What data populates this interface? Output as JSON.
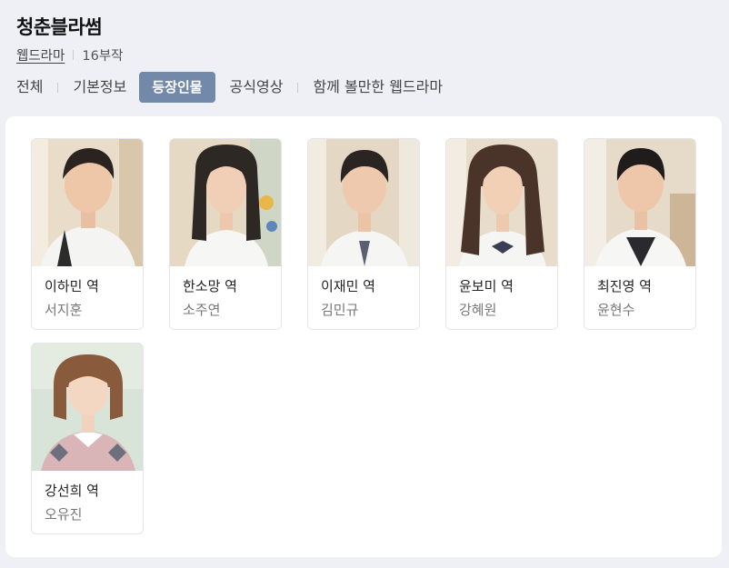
{
  "header": {
    "title": "청춘블라썸",
    "genre": "웹드라마",
    "episodes": "16부작"
  },
  "tabs": [
    {
      "label": "전체"
    },
    {
      "label": "기본정보"
    },
    {
      "label": "등장인물",
      "active": true
    },
    {
      "label": "공식영상"
    },
    {
      "label": "함께 볼만한 웹드라마"
    }
  ],
  "cast": [
    {
      "role": "이하민 역",
      "actor": "서지훈"
    },
    {
      "role": "한소망 역",
      "actor": "소주연"
    },
    {
      "role": "이재민 역",
      "actor": "김민규"
    },
    {
      "role": "윤보미 역",
      "actor": "강혜원"
    },
    {
      "role": "최진영 역",
      "actor": "윤현수"
    },
    {
      "role": "강선희 역",
      "actor": "오유진"
    }
  ],
  "colors": {
    "background": "#eef0f5",
    "active_tab": "#7389a9",
    "panel": "#ffffff"
  }
}
